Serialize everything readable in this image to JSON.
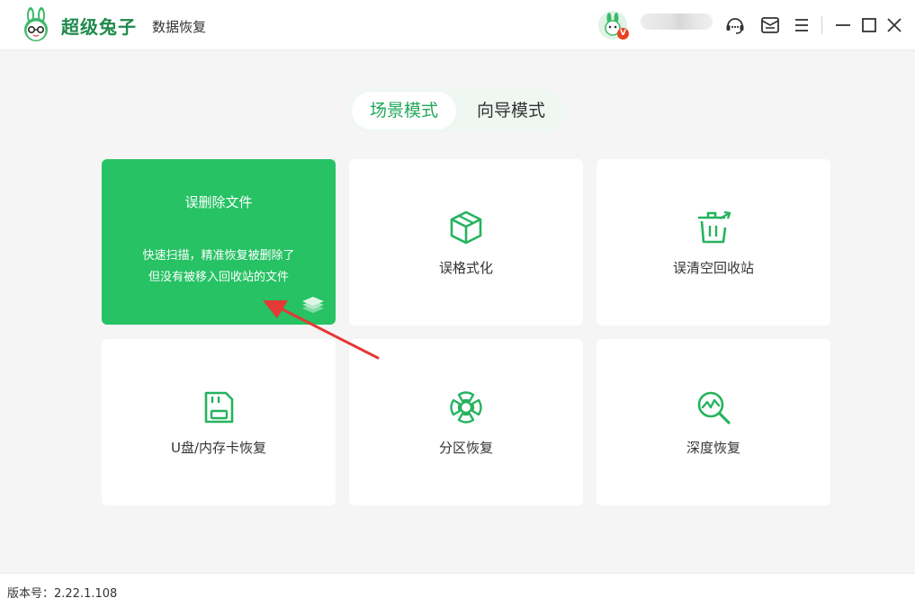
{
  "app": {
    "brand": "超级兔子",
    "subtitle": "数据恢复"
  },
  "header": {
    "vip_badge": "V",
    "icons": [
      "support-icon",
      "message-icon",
      "menu-icon",
      "minimize-icon",
      "maximize-icon",
      "close-icon"
    ]
  },
  "modes": {
    "active": "场景模式",
    "inactive": "向导模式"
  },
  "cards": [
    {
      "title": "误删除文件",
      "desc_line1": "快速扫描，精准恢复被删除了",
      "desc_line2": "但没有被移入回收站的文件",
      "icon": "layers-icon",
      "active": true
    },
    {
      "title": "误格式化",
      "icon": "cube-icon",
      "active": false
    },
    {
      "title": "误清空回收站",
      "icon": "recycle-bin-icon",
      "active": false
    },
    {
      "title": "U盘/内存卡恢复",
      "icon": "sd-card-icon",
      "active": false
    },
    {
      "title": "分区恢复",
      "icon": "partition-icon",
      "active": false
    },
    {
      "title": "深度恢复",
      "icon": "deep-scan-icon",
      "active": false
    }
  ],
  "footer": {
    "version_label": "版本号：2.22.1.108"
  },
  "colors": {
    "accent": "#26c264",
    "accent_dark": "#22a85a",
    "annotation": "#e53935"
  }
}
